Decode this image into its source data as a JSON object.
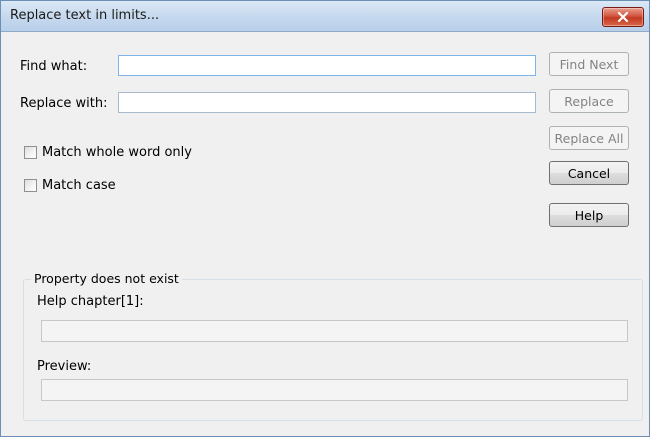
{
  "window": {
    "title": "Replace text in limits..."
  },
  "form": {
    "find_label": "Find what:",
    "find_value": "",
    "replace_label": "Replace with:",
    "replace_value": ""
  },
  "options": {
    "whole_word_label": "Match whole word only",
    "whole_word_checked": false,
    "match_case_label": "Match case",
    "match_case_checked": false
  },
  "buttons": {
    "find_next": "Find Next",
    "replace": "Replace",
    "replace_all": "Replace All",
    "cancel": "Cancel",
    "help": "Help"
  },
  "property_group": {
    "title": "Property does not exist",
    "help_chapter_label": "Help chapter[1]:",
    "help_chapter_value": "",
    "preview_label": "Preview:",
    "preview_value": ""
  }
}
